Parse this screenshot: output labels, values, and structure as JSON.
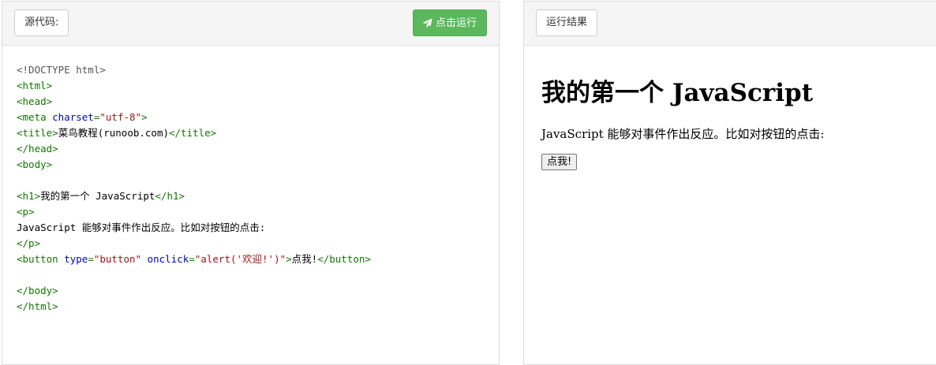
{
  "editor": {
    "tab_label": "源代码:",
    "run_label": "点击运行",
    "run_icon": "paper-plane-icon",
    "code_lines": [
      [
        {
          "t": "doc",
          "v": "<!DOCTYPE html>"
        }
      ],
      [
        {
          "t": "tag",
          "v": "<html>"
        }
      ],
      [
        {
          "t": "tag",
          "v": "<head>"
        }
      ],
      [
        {
          "t": "tag",
          "v": "<meta "
        },
        {
          "t": "attr",
          "v": "charset"
        },
        {
          "t": "tag",
          "v": "="
        },
        {
          "t": "str",
          "v": "\"utf-8\""
        },
        {
          "t": "tag",
          "v": ">"
        }
      ],
      [
        {
          "t": "tag",
          "v": "<title>"
        },
        {
          "t": "text",
          "v": "菜鸟教程(runoob.com)"
        },
        {
          "t": "tag",
          "v": "</title>"
        }
      ],
      [
        {
          "t": "tag",
          "v": "</head>"
        }
      ],
      [
        {
          "t": "tag",
          "v": "<body>"
        }
      ],
      [],
      [
        {
          "t": "tag",
          "v": "<h1>"
        },
        {
          "t": "text",
          "v": "我的第一个 JavaScript"
        },
        {
          "t": "tag",
          "v": "</h1>"
        }
      ],
      [
        {
          "t": "tag",
          "v": "<p>"
        }
      ],
      [
        {
          "t": "text",
          "v": "JavaScript 能够对事件作出反应。比如对按钮的点击:"
        }
      ],
      [
        {
          "t": "tag",
          "v": "</p>"
        }
      ],
      [
        {
          "t": "tag",
          "v": "<button "
        },
        {
          "t": "attr",
          "v": "type"
        },
        {
          "t": "tag",
          "v": "="
        },
        {
          "t": "str",
          "v": "\"button\""
        },
        {
          "t": "text",
          "v": " "
        },
        {
          "t": "attr",
          "v": "onclick"
        },
        {
          "t": "tag",
          "v": "="
        },
        {
          "t": "str",
          "v": "\"alert('欢迎!')\""
        },
        {
          "t": "tag",
          "v": ">"
        },
        {
          "t": "text",
          "v": "点我!"
        },
        {
          "t": "tag",
          "v": "</button>"
        }
      ],
      [],
      [
        {
          "t": "tag",
          "v": "</body>"
        }
      ],
      [
        {
          "t": "tag",
          "v": "</html>"
        }
      ]
    ]
  },
  "result": {
    "tab_label": "运行结果",
    "heading": "我的第一个 JavaScript",
    "paragraph": "JavaScript 能够对事件作出反应。比如对按钮的点击:",
    "button_label": "点我!"
  },
  "colors": {
    "run_button_bg": "#5cb85c",
    "code_tag": "#117700",
    "code_attr": "#0000cc",
    "code_string": "#aa1111"
  }
}
